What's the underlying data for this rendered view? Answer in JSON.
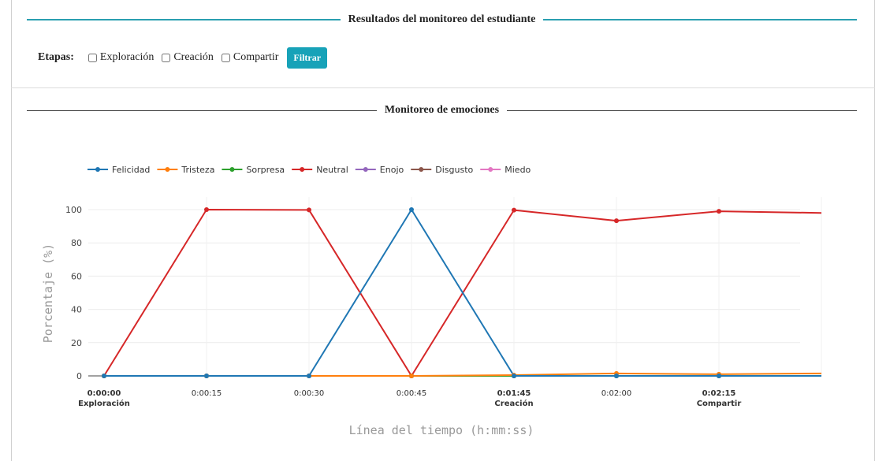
{
  "header": {
    "title": "Resultados del monitoreo del estudiante"
  },
  "filters": {
    "label": "Etapas:",
    "options": [
      {
        "label": "Exploración",
        "checked": false
      },
      {
        "label": "Creación",
        "checked": false
      },
      {
        "label": "Compartir",
        "checked": false
      }
    ],
    "button_label": "Filtrar",
    "accent_color": "#17a2b8"
  },
  "chart_section": {
    "title": "Monitoreo de emociones"
  },
  "chart_data": {
    "type": "line",
    "categories": [
      "0:00:00",
      "0:00:15",
      "0:00:30",
      "0:00:45",
      "0:01:45",
      "0:02:00",
      "0:02:15",
      ""
    ],
    "stage_labels": [
      "Exploración",
      "",
      "",
      "",
      "Creación",
      "",
      "Compartir",
      ""
    ],
    "bold_ticks": [
      true,
      false,
      false,
      false,
      true,
      false,
      true,
      false
    ],
    "xlabel": "Línea del tiempo (h:mm:ss)",
    "ylabel": "Porcentaje (%)",
    "ylim": [
      0,
      100
    ],
    "yticks": [
      0,
      20,
      40,
      60,
      80,
      100
    ],
    "grid": true,
    "legend_position": "top-left",
    "series": [
      {
        "name": "Felicidad",
        "color": "#1f77b4",
        "values": [
          0,
          0,
          0,
          100,
          0,
          0,
          0,
          0
        ]
      },
      {
        "name": "Tristeza",
        "color": "#ff7f0e",
        "values": [
          0,
          0,
          0,
          0,
          0.5,
          1.5,
          1,
          1.5
        ]
      },
      {
        "name": "Sorpresa",
        "color": "#2ca02c",
        "values": [
          0,
          0,
          0,
          0,
          0,
          0,
          0,
          0
        ]
      },
      {
        "name": "Neutral",
        "color": "#d62728",
        "values": [
          0,
          100,
          99.8,
          0,
          99.7,
          93.3,
          99,
          98
        ]
      },
      {
        "name": "Enojo",
        "color": "#9467bd",
        "values": [
          0,
          0,
          0,
          0,
          0,
          0,
          0,
          0
        ]
      },
      {
        "name": "Disgusto",
        "color": "#8c564b",
        "values": [
          0,
          0,
          0,
          0,
          0,
          0,
          0,
          0
        ]
      },
      {
        "name": "Miedo",
        "color": "#e377c2",
        "values": [
          0,
          0,
          0,
          0,
          0,
          0,
          0,
          0
        ]
      }
    ]
  }
}
